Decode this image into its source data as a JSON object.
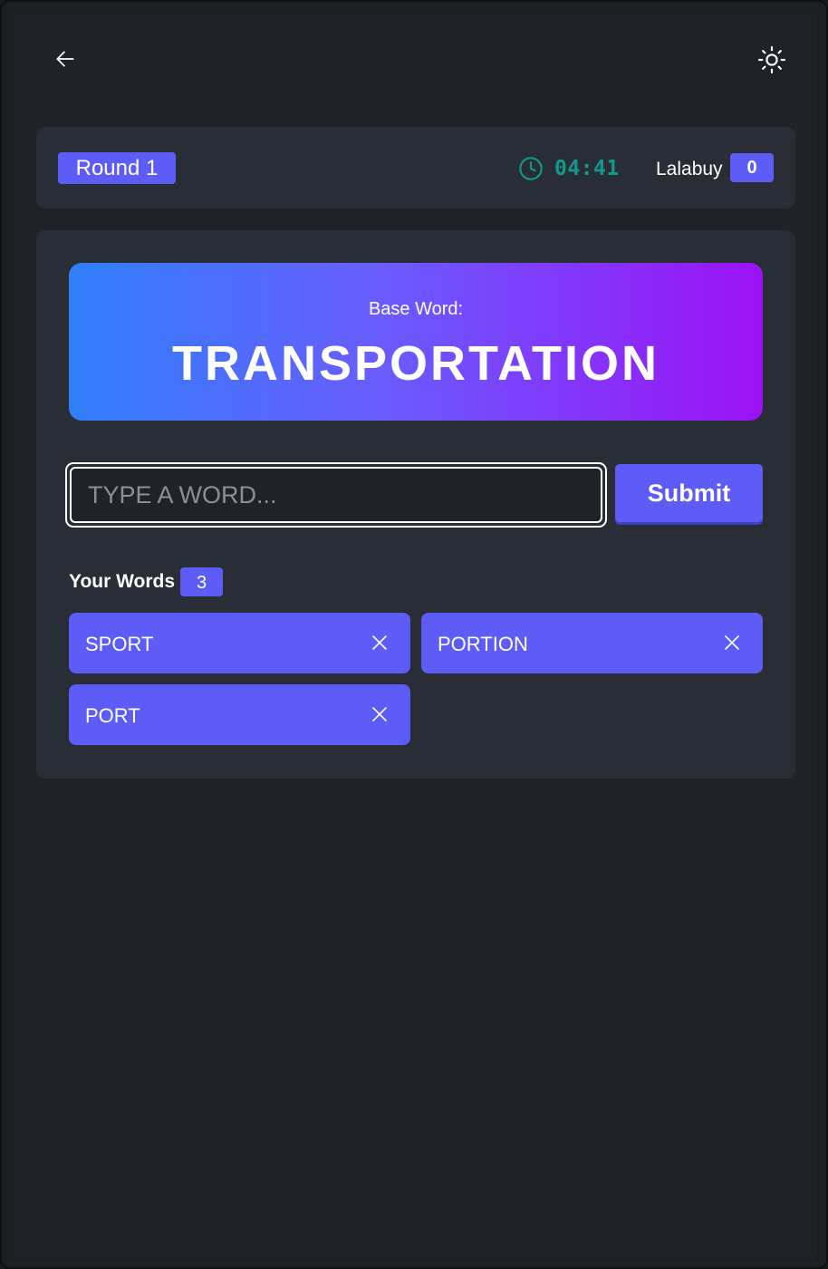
{
  "header": {
    "back_icon": "arrow-left-icon",
    "theme_icon": "sun-icon"
  },
  "status": {
    "round_label": "Round 1",
    "timer_icon": "clock-icon",
    "timer": "04:41",
    "player_name": "Lalabuy",
    "score": "0"
  },
  "game": {
    "base_label": "Base Word:",
    "base_word": "TRANSPORTATION",
    "input_placeholder": "TYPE A WORD...",
    "input_value": "",
    "submit_label": "Submit",
    "words_label": "Your Words",
    "words_count": "3",
    "words": [
      {
        "text": "SPORT",
        "remove_icon": "close-icon"
      },
      {
        "text": "PORTION",
        "remove_icon": "close-icon"
      },
      {
        "text": "PORT",
        "remove_icon": "close-icon"
      }
    ]
  },
  "colors": {
    "accent": "#5e5cf7",
    "timer": "#13988a",
    "card": "#282d36",
    "background": "#1f2229",
    "gradient_start": "#2f7ff9",
    "gradient_end": "#9b12f6"
  }
}
